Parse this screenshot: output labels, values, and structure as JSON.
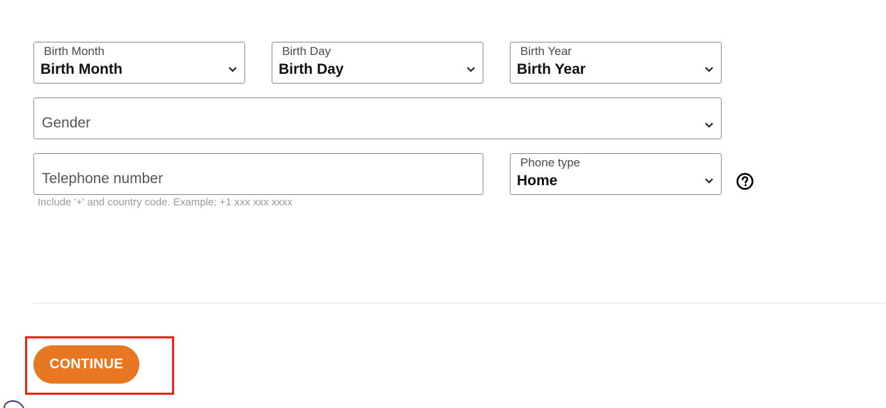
{
  "birth_month": {
    "label": "Birth Month",
    "value": "Birth Month"
  },
  "birth_day": {
    "label": "Birth Day",
    "value": "Birth Day"
  },
  "birth_year": {
    "label": "Birth Year",
    "value": "Birth Year"
  },
  "gender": {
    "placeholder": "Gender"
  },
  "telephone": {
    "placeholder": "Telephone number",
    "hint": "Include '+' and country code. Example: +1 xxx xxx xxxx"
  },
  "phone_type": {
    "label": "Phone type",
    "value": "Home"
  },
  "continue_button": {
    "label": "CONTINUE"
  },
  "colors": {
    "accent_orange": "#e87722",
    "highlight_red": "#e8231c"
  },
  "icons": {
    "chevron": "chevron-down-icon",
    "help": "help-icon"
  }
}
